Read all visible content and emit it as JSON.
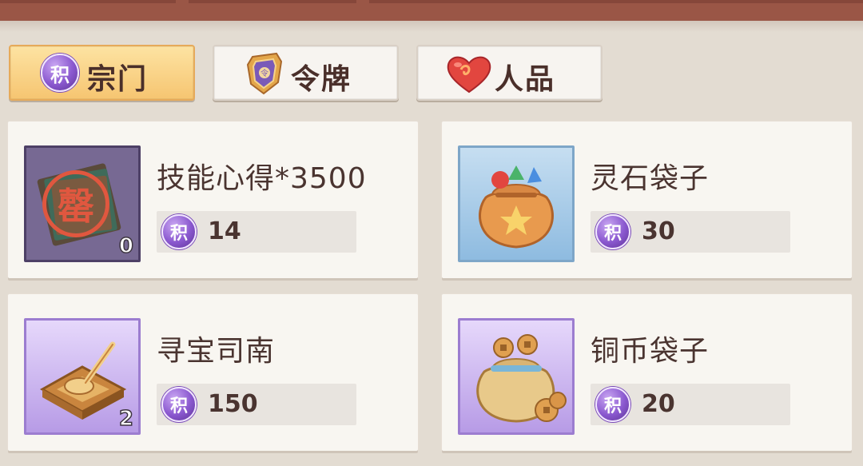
{
  "tabs": [
    {
      "label": "宗门",
      "icon": "sect-points-coin-icon",
      "icon_text": "积",
      "active": true
    },
    {
      "label": "令牌",
      "icon": "token-medal-icon",
      "active": false
    },
    {
      "label": "人品",
      "icon": "heart-icon",
      "active": false
    }
  ],
  "currency": {
    "symbol": "积",
    "icon": "points-coin-icon"
  },
  "items": [
    {
      "name": "技能心得*3500",
      "price": "14",
      "owned": "0",
      "icon": "skill-book-icon",
      "stamp": "罄"
    },
    {
      "name": "灵石袋子",
      "price": "30",
      "owned": "",
      "icon": "spirit-stone-bag-icon"
    },
    {
      "name": "寻宝司南",
      "price": "150",
      "owned": "2",
      "icon": "compass-spoon-icon"
    },
    {
      "name": "铜币袋子",
      "price": "20",
      "owned": "",
      "icon": "copper-coin-bag-icon"
    }
  ],
  "colors": {
    "top_bar": "#9a5646",
    "active_tab": "#f6c571",
    "card_bg": "#f8f6f1",
    "text": "#4a3430",
    "coin_purple": "#8a58cf"
  }
}
